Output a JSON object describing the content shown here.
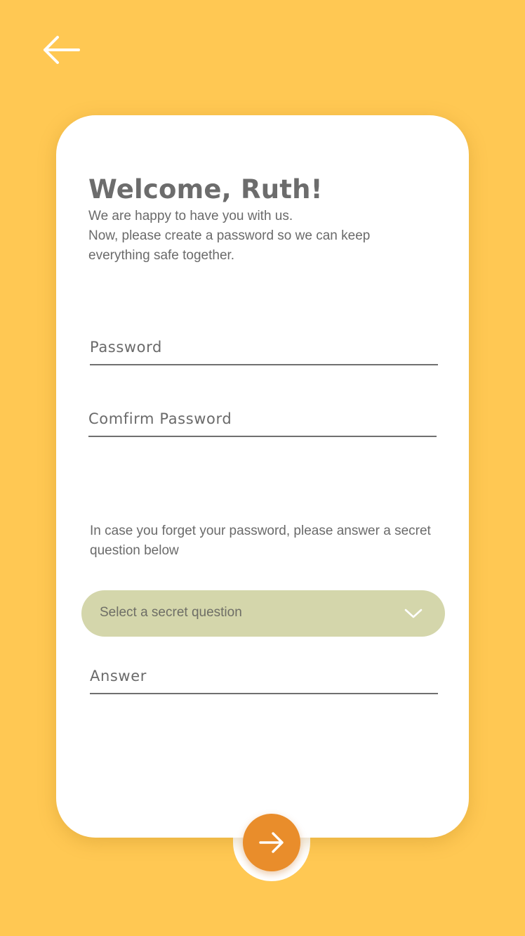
{
  "header": {
    "back_icon": "arrow-left-icon"
  },
  "card": {
    "title": "Welcome, Ruth!",
    "intro_line1": "We are happy to have you with us.",
    "intro_line2": "Now, please create a password so we can keep everything safe together.",
    "password_placeholder": "Password",
    "confirm_placeholder": "Comfirm Password",
    "hint": "In case you forget your password, please answer a secret question below",
    "secret_question": {
      "selected": "Select a secret question",
      "icon": "chevron-down-icon"
    },
    "answer_placeholder": "Answer"
  },
  "footer": {
    "next_icon": "arrow-right-icon"
  },
  "colors": {
    "background": "#FFC853",
    "card": "#FFFFFF",
    "accent": "#E98D2B",
    "select_bg": "#D4D6AB",
    "text": "#6C6C6C"
  }
}
